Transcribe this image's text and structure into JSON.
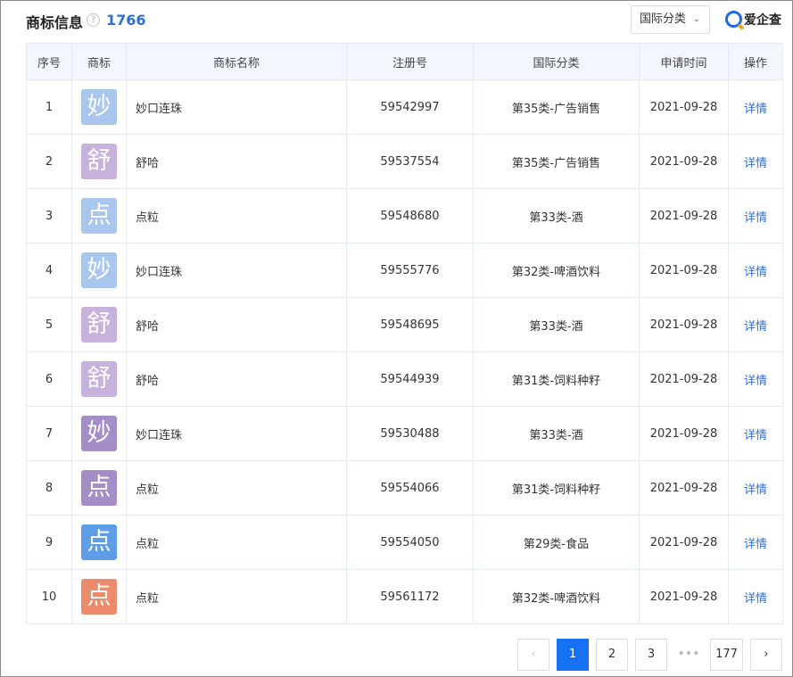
{
  "header": {
    "title": "商标信息",
    "help_icon": "?",
    "count": "1766",
    "filter_label": "国际分类",
    "filter_chevron": "chevron-down-icon",
    "logo_text": "爱企查"
  },
  "table": {
    "columns": [
      "序号",
      "商标",
      "商标名称",
      "注册号",
      "国际分类",
      "申请时间",
      "操作"
    ],
    "rows": [
      {
        "index": "1",
        "logo_char": "妙",
        "logo_color": "#a9c6ef",
        "name": "妙口连珠",
        "reg_no": "59542997",
        "category": "第35类-广告销售",
        "date": "2021-09-28",
        "action": "详情"
      },
      {
        "index": "2",
        "logo_char": "舒",
        "logo_color": "#c6b2dc",
        "name": "舒哈",
        "reg_no": "59537554",
        "category": "第35类-广告销售",
        "date": "2021-09-28",
        "action": "详情"
      },
      {
        "index": "3",
        "logo_char": "点",
        "logo_color": "#a9c6ef",
        "name": "点粒",
        "reg_no": "59548680",
        "category": "第33类-酒",
        "date": "2021-09-28",
        "action": "详情"
      },
      {
        "index": "4",
        "logo_char": "妙",
        "logo_color": "#a9c6ef",
        "name": "妙口连珠",
        "reg_no": "59555776",
        "category": "第32类-啤酒饮料",
        "date": "2021-09-28",
        "action": "详情"
      },
      {
        "index": "5",
        "logo_char": "舒",
        "logo_color": "#c6b2dc",
        "name": "舒哈",
        "reg_no": "59548695",
        "category": "第33类-酒",
        "date": "2021-09-28",
        "action": "详情"
      },
      {
        "index": "6",
        "logo_char": "舒",
        "logo_color": "#c6b2dc",
        "name": "舒哈",
        "reg_no": "59544939",
        "category": "第31类-饲料种籽",
        "date": "2021-09-28",
        "action": "详情"
      },
      {
        "index": "7",
        "logo_char": "妙",
        "logo_color": "#a58dc8",
        "name": "妙口连珠",
        "reg_no": "59530488",
        "category": "第33类-酒",
        "date": "2021-09-28",
        "action": "详情"
      },
      {
        "index": "8",
        "logo_char": "点",
        "logo_color": "#a58dc8",
        "name": "点粒",
        "reg_no": "59554066",
        "category": "第31类-饲料种籽",
        "date": "2021-09-28",
        "action": "详情"
      },
      {
        "index": "9",
        "logo_char": "点",
        "logo_color": "#5e9ee6",
        "name": "点粒",
        "reg_no": "59554050",
        "category": "第29类-食品",
        "date": "2021-09-28",
        "action": "详情"
      },
      {
        "index": "10",
        "logo_char": "点",
        "logo_color": "#ec8a6c",
        "name": "点粒",
        "reg_no": "59561172",
        "category": "第32类-啤酒饮料",
        "date": "2021-09-28",
        "action": "详情"
      }
    ]
  },
  "pagination": {
    "prev": "‹",
    "pages": [
      "1",
      "2",
      "3"
    ],
    "current": "1",
    "ellipsis": "•••",
    "last": "177",
    "next": "›"
  },
  "colors": {
    "accent": "#1672f3",
    "link": "#2f6fd6",
    "header_bg": "#f2f6fd"
  }
}
